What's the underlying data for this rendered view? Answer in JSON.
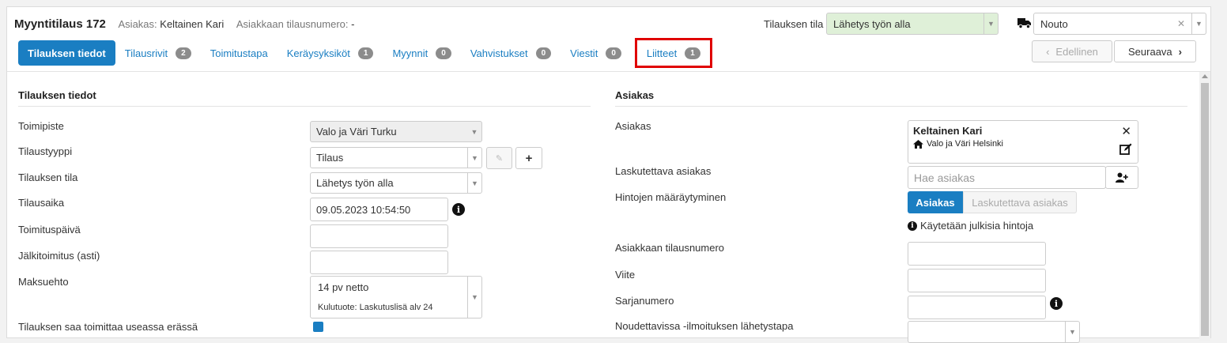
{
  "header": {
    "title": "Myyntitilaus 172",
    "customer_label": "Asiakas:",
    "customer_value": "Keltainen Kari",
    "order_no_label": "Asiakkaan tilausnumero:",
    "order_no_value": "-",
    "state_label": "Tilauksen tila",
    "state_value": "Lähetys työn alla",
    "shipping_value": "Nouto",
    "prev_label": "Edellinen",
    "next_label": "Seuraava"
  },
  "tabs": [
    {
      "label": "Tilauksen tiedot",
      "badge": null,
      "active": true
    },
    {
      "label": "Tilausrivit",
      "badge": "2"
    },
    {
      "label": "Toimitustapa",
      "badge": null
    },
    {
      "label": "Keräysyksiköt",
      "badge": "1"
    },
    {
      "label": "Myynnit",
      "badge": "0"
    },
    {
      "label": "Vahvistukset",
      "badge": "0"
    },
    {
      "label": "Viestit",
      "badge": "0"
    },
    {
      "label": "Liitteet",
      "badge": "1",
      "highlighted": true
    }
  ],
  "left": {
    "section_title": "Tilauksen tiedot",
    "office_label": "Toimipiste",
    "office_value": "Valo ja Väri Turku",
    "type_label": "Tilaustyyppi",
    "type_value": "Tilaus",
    "state_label": "Tilauksen tila",
    "state_value": "Lähetys työn alla",
    "time_label": "Tilausaika",
    "time_value": "09.05.2023 10:54:50",
    "delivery_label": "Toimituspäivä",
    "delivery_value": "",
    "backorder_label": "Jälkitoimitus (asti)",
    "backorder_value": "",
    "terms_label": "Maksuehto",
    "terms_value": "14 pv netto",
    "terms_sub": "Kulutuote: Laskutuslisä alv 24",
    "partial_label": "Tilauksen saa toimittaa useassa erässä"
  },
  "right": {
    "section_title": "Asiakas",
    "customer_label": "Asiakas",
    "customer_name": "Keltainen Kari",
    "customer_branch": "Valo ja Väri Helsinki",
    "billing_label": "Laskutettava asiakas",
    "billing_placeholder": "Hae asiakas",
    "pricing_label": "Hintojen määräytyminen",
    "pricing_on": "Asiakas",
    "pricing_off": "Laskutettava asiakas",
    "pricing_hint": "Käytetään julkisia hintoja",
    "order_no_label": "Asiakkaan tilausnumero",
    "ref_label": "Viite",
    "serial_label": "Sarjanumero",
    "notify_label": "Noudettavissa -ilmoituksen lähetystapa"
  },
  "colors": {
    "accent": "#1a7ec2",
    "state_bg": "#dff0d8",
    "highlight": "#e00000",
    "badge": "#8c8c8c"
  }
}
